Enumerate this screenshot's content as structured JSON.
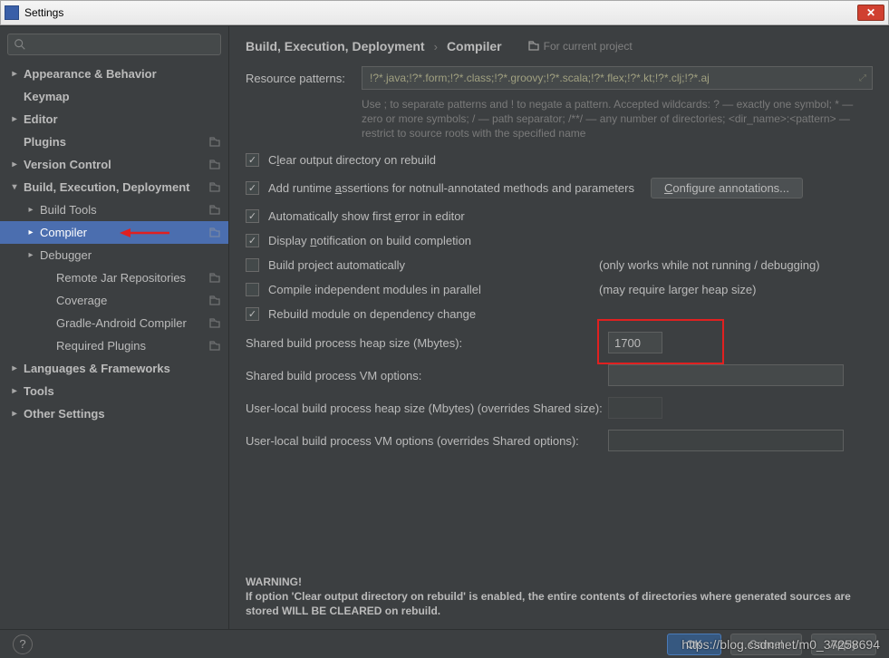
{
  "window": {
    "title": "Settings"
  },
  "search": {
    "placeholder": ""
  },
  "sidebar": {
    "items": [
      {
        "label": "Appearance & Behavior",
        "bold": true,
        "arrow": ">"
      },
      {
        "label": "Keymap",
        "bold": true
      },
      {
        "label": "Editor",
        "bold": true,
        "arrow": ">"
      },
      {
        "label": "Plugins",
        "bold": true,
        "proj": true
      },
      {
        "label": "Version Control",
        "bold": true,
        "arrow": ">",
        "proj": true
      },
      {
        "label": "Build, Execution, Deployment",
        "bold": true,
        "arrow": "v",
        "proj": true
      },
      {
        "label": "Build Tools",
        "indent": 1,
        "arrow": ">",
        "proj": true
      },
      {
        "label": "Compiler",
        "indent": 1,
        "arrow": ">",
        "proj": true,
        "selected": true,
        "redarrow": true
      },
      {
        "label": "Debugger",
        "indent": 1,
        "arrow": ">"
      },
      {
        "label": "Remote Jar Repositories",
        "indent": 2,
        "proj": true
      },
      {
        "label": "Coverage",
        "indent": 2,
        "proj": true
      },
      {
        "label": "Gradle-Android Compiler",
        "indent": 2,
        "proj": true
      },
      {
        "label": "Required Plugins",
        "indent": 2,
        "proj": true
      },
      {
        "label": "Languages & Frameworks",
        "bold": true,
        "arrow": ">"
      },
      {
        "label": "Tools",
        "bold": true,
        "arrow": ">"
      },
      {
        "label": "Other Settings",
        "bold": true,
        "arrow": ">"
      }
    ]
  },
  "breadcrumb": {
    "main": "Build, Execution, Deployment",
    "last": "Compiler",
    "scope": "For current project"
  },
  "patterns": {
    "label": "Resource patterns:",
    "value": "!?*.java;!?*.form;!?*.class;!?*.groovy;!?*.scala;!?*.flex;!?*.kt;!?*.clj;!?*.aj",
    "help": "Use ; to separate patterns and ! to negate a pattern. Accepted wildcards: ? — exactly one symbol; * — zero or more symbols; / — path separator; /**/ — any number of directories; <dir_name>:<pattern> — restrict to source roots with the specified name"
  },
  "checks": {
    "clear": "Clear output directory on rebuild",
    "assertions": "Add runtime assertions for notnull-annotated methods and parameters",
    "configure": "Configure annotations...",
    "autoerror": "Automatically show first error in editor",
    "notify": "Display notification on build completion",
    "buildauto": "Build project automatically",
    "buildauto_note": "(only works while not running / debugging)",
    "parallel": "Compile independent modules in parallel",
    "parallel_note": "(may require larger heap size)",
    "rebuild": "Rebuild module on dependency change"
  },
  "fields": {
    "heap": {
      "label": "Shared build process heap size (Mbytes):",
      "value": "1700"
    },
    "vm": {
      "label": "Shared build process VM options:",
      "value": ""
    },
    "uheap": {
      "label": "User-local build process heap size (Mbytes) (overrides Shared size):",
      "value": ""
    },
    "uvm": {
      "label": "User-local build process VM options (overrides Shared options):",
      "value": ""
    }
  },
  "warning": {
    "title": "WARNING!",
    "text": "If option 'Clear output directory on rebuild' is enabled, the entire contents of directories where generated sources are stored WILL BE CLEARED on rebuild."
  },
  "footer": {
    "ok": "OK",
    "cancel": "Cancel",
    "apply": "Apply"
  },
  "watermark": "https://blog.csdn.net/m0_37258694"
}
